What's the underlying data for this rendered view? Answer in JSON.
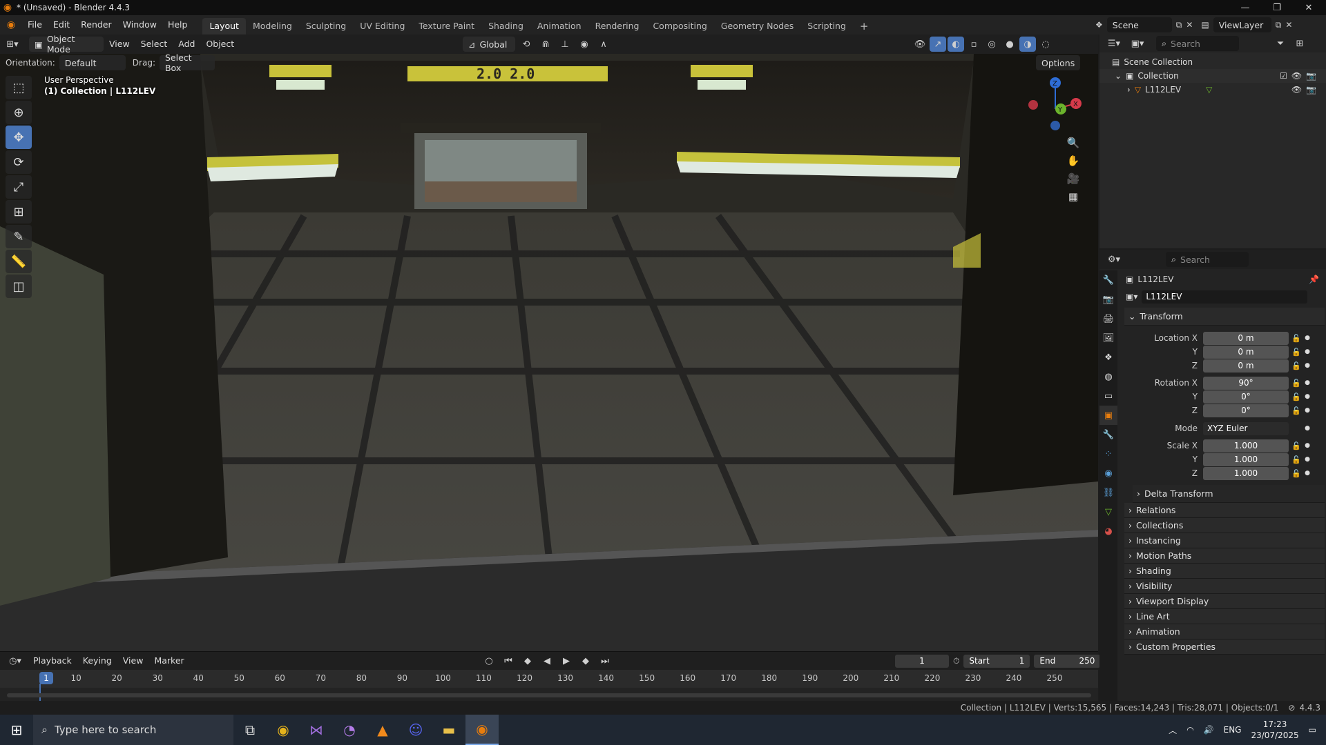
{
  "window": {
    "title": "* (Unsaved) - Blender 4.4.3"
  },
  "menu": [
    "File",
    "Edit",
    "Render",
    "Window",
    "Help"
  ],
  "workspaces": [
    "Layout",
    "Modeling",
    "Sculpting",
    "UV Editing",
    "Texture Paint",
    "Shading",
    "Animation",
    "Rendering",
    "Compositing",
    "Geometry Nodes",
    "Scripting"
  ],
  "active_workspace": "Layout",
  "scene": {
    "name": "Scene",
    "view_layer": "ViewLayer"
  },
  "viewport_header": {
    "mode": "Object Mode",
    "menus": [
      "View",
      "Select",
      "Add",
      "Object"
    ],
    "transform_orientation": "Global"
  },
  "tool_header": {
    "orientation_label": "Orientation:",
    "orientation_value": "Default",
    "drag_label": "Drag:",
    "drag_value": "Select Box",
    "options": "Options"
  },
  "viewport_info": {
    "line1": "User Perspective",
    "line2": "(1) Collection | L112LEV"
  },
  "scene_text": {
    "sign": "2.0 2.0"
  },
  "gizmo": {
    "x": "X",
    "y": "Y",
    "z": "Z"
  },
  "outliner": {
    "search_placeholder": "Search",
    "root": "Scene Collection",
    "collection": "Collection",
    "object": "L112LEV"
  },
  "properties": {
    "search_placeholder": "Search",
    "object_name": "L112LEV",
    "datablock": "L112LEV",
    "transform_title": "Transform",
    "location": {
      "label": "Location X",
      "x": "0 m",
      "y": "0 m",
      "z": "0 m"
    },
    "rotation": {
      "label": "Rotation X",
      "x": "90°",
      "y": "0°",
      "z": "0°"
    },
    "mode": {
      "label": "Mode",
      "value": "XYZ Euler"
    },
    "scale": {
      "label": "Scale X",
      "x": "1.000",
      "y": "1.000",
      "z": "1.000"
    },
    "axis_y": "Y",
    "axis_z": "Z",
    "delta": "Delta Transform",
    "sections": [
      "Relations",
      "Collections",
      "Instancing",
      "Motion Paths",
      "Shading",
      "Visibility",
      "Viewport Display",
      "Line Art",
      "Animation",
      "Custom Properties"
    ]
  },
  "timeline": {
    "menus": [
      "Playback",
      "Keying",
      "View",
      "Marker"
    ],
    "current_frame": "1",
    "start_label": "Start",
    "start": "1",
    "end_label": "End",
    "end": "250",
    "ticks": [
      "1",
      "10",
      "20",
      "30",
      "40",
      "50",
      "60",
      "70",
      "80",
      "90",
      "100",
      "110",
      "120",
      "130",
      "140",
      "150",
      "160",
      "170",
      "180",
      "190",
      "200",
      "210",
      "220",
      "230",
      "240",
      "250"
    ]
  },
  "statusbar": {
    "text": "Collection | L112LEV | Verts:15,565 | Faces:14,243 | Tris:28,071 | Objects:0/1",
    "version": "4.4.3"
  },
  "taskbar": {
    "search_placeholder": "Type here to search",
    "lang": "ENG",
    "time": "17:23",
    "date": "23/07/2025"
  },
  "colors": {
    "accent": "#4772b3",
    "blender_orange": "#e87d0d"
  }
}
